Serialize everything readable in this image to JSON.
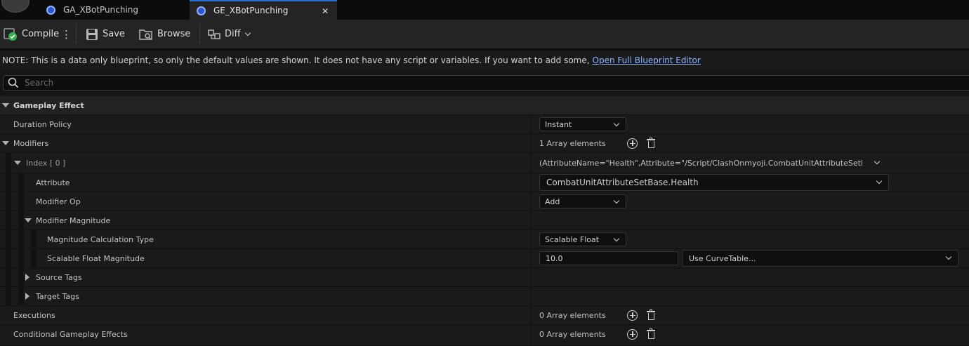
{
  "tabs": [
    {
      "label": "GA_XBotPunching",
      "active": false
    },
    {
      "label": "GE_XBotPunching",
      "active": true
    }
  ],
  "toolbar": {
    "compile_label": "Compile",
    "save_label": "Save",
    "browse_label": "Browse",
    "diff_label": "Diff"
  },
  "note": {
    "text": "NOTE: This is a data only blueprint, so only the default values are shown.  It does not have any script or variables.  If you want to add some,",
    "link_text": "Open Full Blueprint Editor"
  },
  "search": {
    "placeholder": "Search",
    "value": ""
  },
  "details": {
    "category": "Gameplay Effect",
    "duration_policy": {
      "label": "Duration Policy",
      "value": "Instant"
    },
    "modifiers": {
      "label": "Modifiers",
      "count_text": "1 Array elements"
    },
    "index0": {
      "label": "Index [ 0 ]",
      "summary": "(AttributeName=\"Health\",Attribute=\"/Script/ClashOnmyoji.CombatUnitAttributeSetBase:Hea"
    },
    "attribute": {
      "label": "Attribute",
      "value": "CombatUnitAttributeSetBase.Health"
    },
    "modifier_op": {
      "label": "Modifier Op",
      "value": "Add"
    },
    "modifier_magnitude": {
      "label": "Modifier Magnitude"
    },
    "magnitude_calc_type": {
      "label": "Magnitude Calculation Type",
      "value": "Scalable Float"
    },
    "scalable_float": {
      "label": "Scalable Float Magnitude",
      "value": "10.0",
      "curve_value": "Use CurveTable..."
    },
    "source_tags": {
      "label": "Source Tags"
    },
    "target_tags": {
      "label": "Target Tags"
    },
    "executions": {
      "label": "Executions",
      "count_text": "0 Array elements"
    },
    "conditional_effects": {
      "label": "Conditional Gameplay Effects",
      "count_text": "0 Array elements"
    }
  },
  "colors": {
    "accent": "#2a6fd6",
    "link": "#8fb4ff",
    "background": "#1a1a1a"
  }
}
